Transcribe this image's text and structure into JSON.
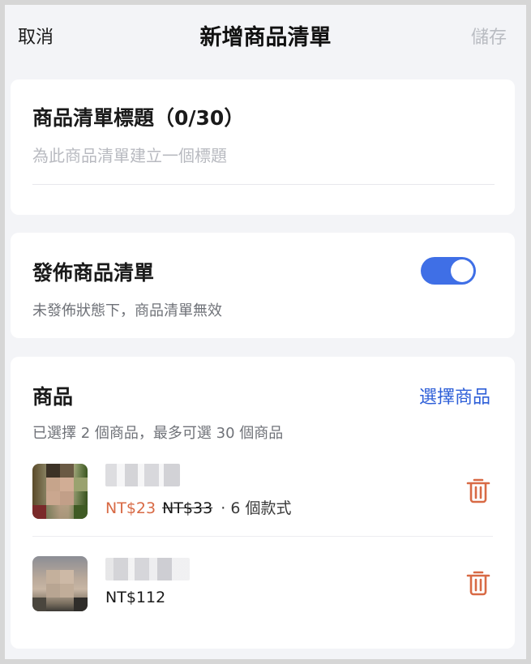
{
  "navbar": {
    "cancel_label": "取消",
    "title": "新增商品清單",
    "save_label": "儲存"
  },
  "title_section": {
    "label": "商品清單標題（0/30）",
    "placeholder": "為此商品清單建立一個標題",
    "value": ""
  },
  "publish_section": {
    "label": "發佈商品清單",
    "hint": "未發佈狀態下，商品清單無效",
    "toggle_on": true
  },
  "products_section": {
    "label": "商品",
    "select_label": "選擇商品",
    "hint": "已選擇 2 個商品，最多可選 30 個商品",
    "items": [
      {
        "sale_price": "NT$23",
        "original_price": "NT$33",
        "variants": "· 6 個款式"
      },
      {
        "price": "NT$112"
      }
    ]
  },
  "colors": {
    "accent": "#3f6fe6",
    "link": "#2e5fd8",
    "sale": "#d86a45",
    "muted": "#b9bcc2"
  },
  "icons": [
    "trash-icon"
  ]
}
